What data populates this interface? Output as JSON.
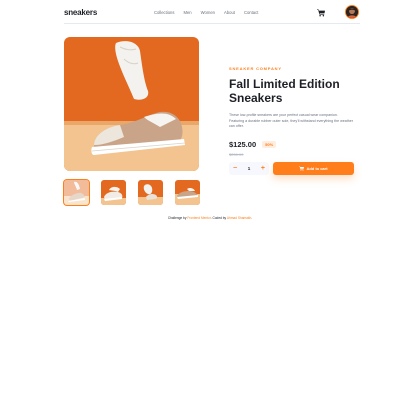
{
  "nav": {
    "logo": "sneakers",
    "menu": [
      "Collections",
      "Men",
      "Women",
      "About",
      "Contact"
    ],
    "cart_icon": "cart-icon",
    "avatar_icon": "avatar"
  },
  "product": {
    "company": "SNEAKER COMPANY",
    "title": "Fall Limited Edition Sneakers",
    "description": "These low-profile sneakers are your perfect casual wear companion. Featuring a durable rubber outer sole, they'll withstand everything the weather can offer.",
    "price": "$125.00",
    "discount": "50%",
    "old_price": "$250.00",
    "quantity": "1",
    "minus": "−",
    "plus": "+",
    "add_to_cart": "Add to cart"
  },
  "footer": {
    "text1": "Challenge by ",
    "link1": "Frontend Mentor",
    "text2": ". Coded by ",
    "link2": "Ahmad Shamakh",
    "text3": "."
  },
  "colors": {
    "accent": "#ff7e1b",
    "accent_pale": "#ffede0",
    "dark": "#1d2026",
    "grey": "#69707d"
  }
}
